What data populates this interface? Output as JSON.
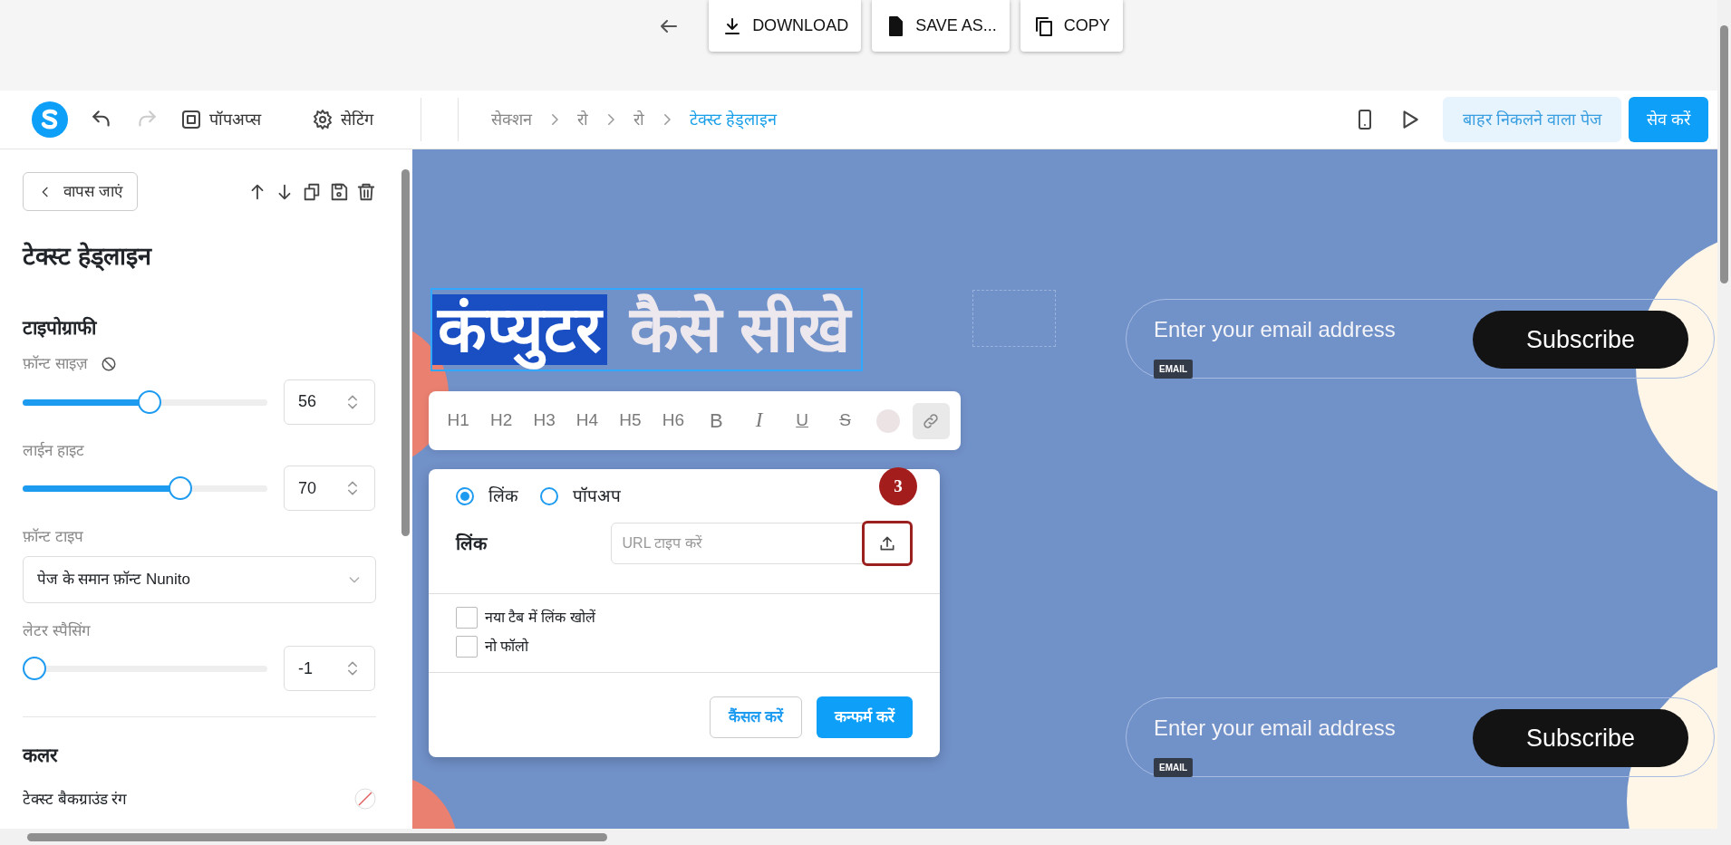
{
  "export_bar": {
    "buttons": [
      {
        "label": "DOWNLOAD",
        "kind": "download"
      },
      {
        "label": "SAVE AS...",
        "kind": "save"
      },
      {
        "label": "COPY",
        "kind": "copy"
      }
    ]
  },
  "header": {
    "history": [
      {
        "kind": "undo",
        "disabled": false
      },
      {
        "kind": "redo",
        "disabled": true
      }
    ],
    "menu": [
      {
        "label": "पॉपअप्स",
        "kind": "popups"
      },
      {
        "label": "सेटिंग",
        "kind": "settings"
      }
    ],
    "breadcrumb": [
      {
        "label": "सेक्शन",
        "selected": false
      },
      {
        "label": "रो",
        "selected": false
      },
      {
        "label": "रो",
        "selected": false
      },
      {
        "label": "टेक्स्ट हेड्लाइन",
        "selected": true
      }
    ],
    "exit_button": "बाहर निकलने वाला पेज",
    "save_button": "सेव करें"
  },
  "panel": {
    "back_button": "वापस जाएं",
    "title": "टेक्स्ट हेड्लाइन",
    "typography_heading": "टाइपोग्राफी",
    "controls": [
      {
        "kind": "slider",
        "label": "फ़ॉन्ट साइज़",
        "reset": true,
        "level": 0.52,
        "value": "56"
      },
      {
        "kind": "slider",
        "label": "लाईन हाइट",
        "reset": false,
        "level": 0.66,
        "value": "70"
      },
      {
        "kind": "select",
        "label": "फ़ॉन्ट टाइप",
        "value": "पेज के समान फ़ॉन्ट Nunito"
      },
      {
        "kind": "slider",
        "label": "लेटर स्पैसिंग",
        "reset": false,
        "level": 0,
        "value": "-1"
      }
    ],
    "color_heading": "कलर",
    "color_rows": [
      {
        "label": "टेक्स्ट बैकग्राउंड रंग"
      }
    ]
  },
  "canvas": {
    "headline": [
      {
        "text": "कंप्युटर",
        "selected": true
      },
      {
        "text": " कैसे सीखे",
        "selected": false
      }
    ],
    "toolbar": [
      {
        "kind": "text",
        "label": "H1"
      },
      {
        "kind": "text",
        "label": "H2"
      },
      {
        "kind": "text",
        "label": "H3"
      },
      {
        "kind": "text",
        "label": "H4"
      },
      {
        "kind": "text",
        "label": "H5"
      },
      {
        "kind": "text",
        "label": "H6"
      },
      {
        "kind": "bold",
        "label": "B"
      },
      {
        "kind": "italic",
        "label": "I"
      },
      {
        "kind": "underline",
        "label": "U"
      },
      {
        "kind": "strike",
        "label": "S"
      },
      {
        "kind": "color",
        "selected": false
      },
      {
        "kind": "link",
        "selected": true
      }
    ],
    "link_dialog": {
      "options": [
        {
          "label": "लिंक",
          "selected": true
        },
        {
          "label": "पॉपअप",
          "selected": false
        }
      ],
      "field_label": "लिंक",
      "placeholder": "URL टाइप करें",
      "step_badge": "3",
      "checkboxes": [
        {
          "label": "नया टैब में लिंक खोलें",
          "checked": false
        },
        {
          "label": "नो फॉलो",
          "checked": false
        }
      ],
      "cancel_button": "कैंसल करें",
      "confirm_button": "कन्फर्म करें"
    },
    "forms": [
      {
        "placeholder": "Enter your email address",
        "tag": "EMAIL",
        "button": "Subscribe"
      },
      {
        "placeholder": "Enter your email address",
        "tag": "EMAIL",
        "button": "Subscribe"
      }
    ]
  }
}
